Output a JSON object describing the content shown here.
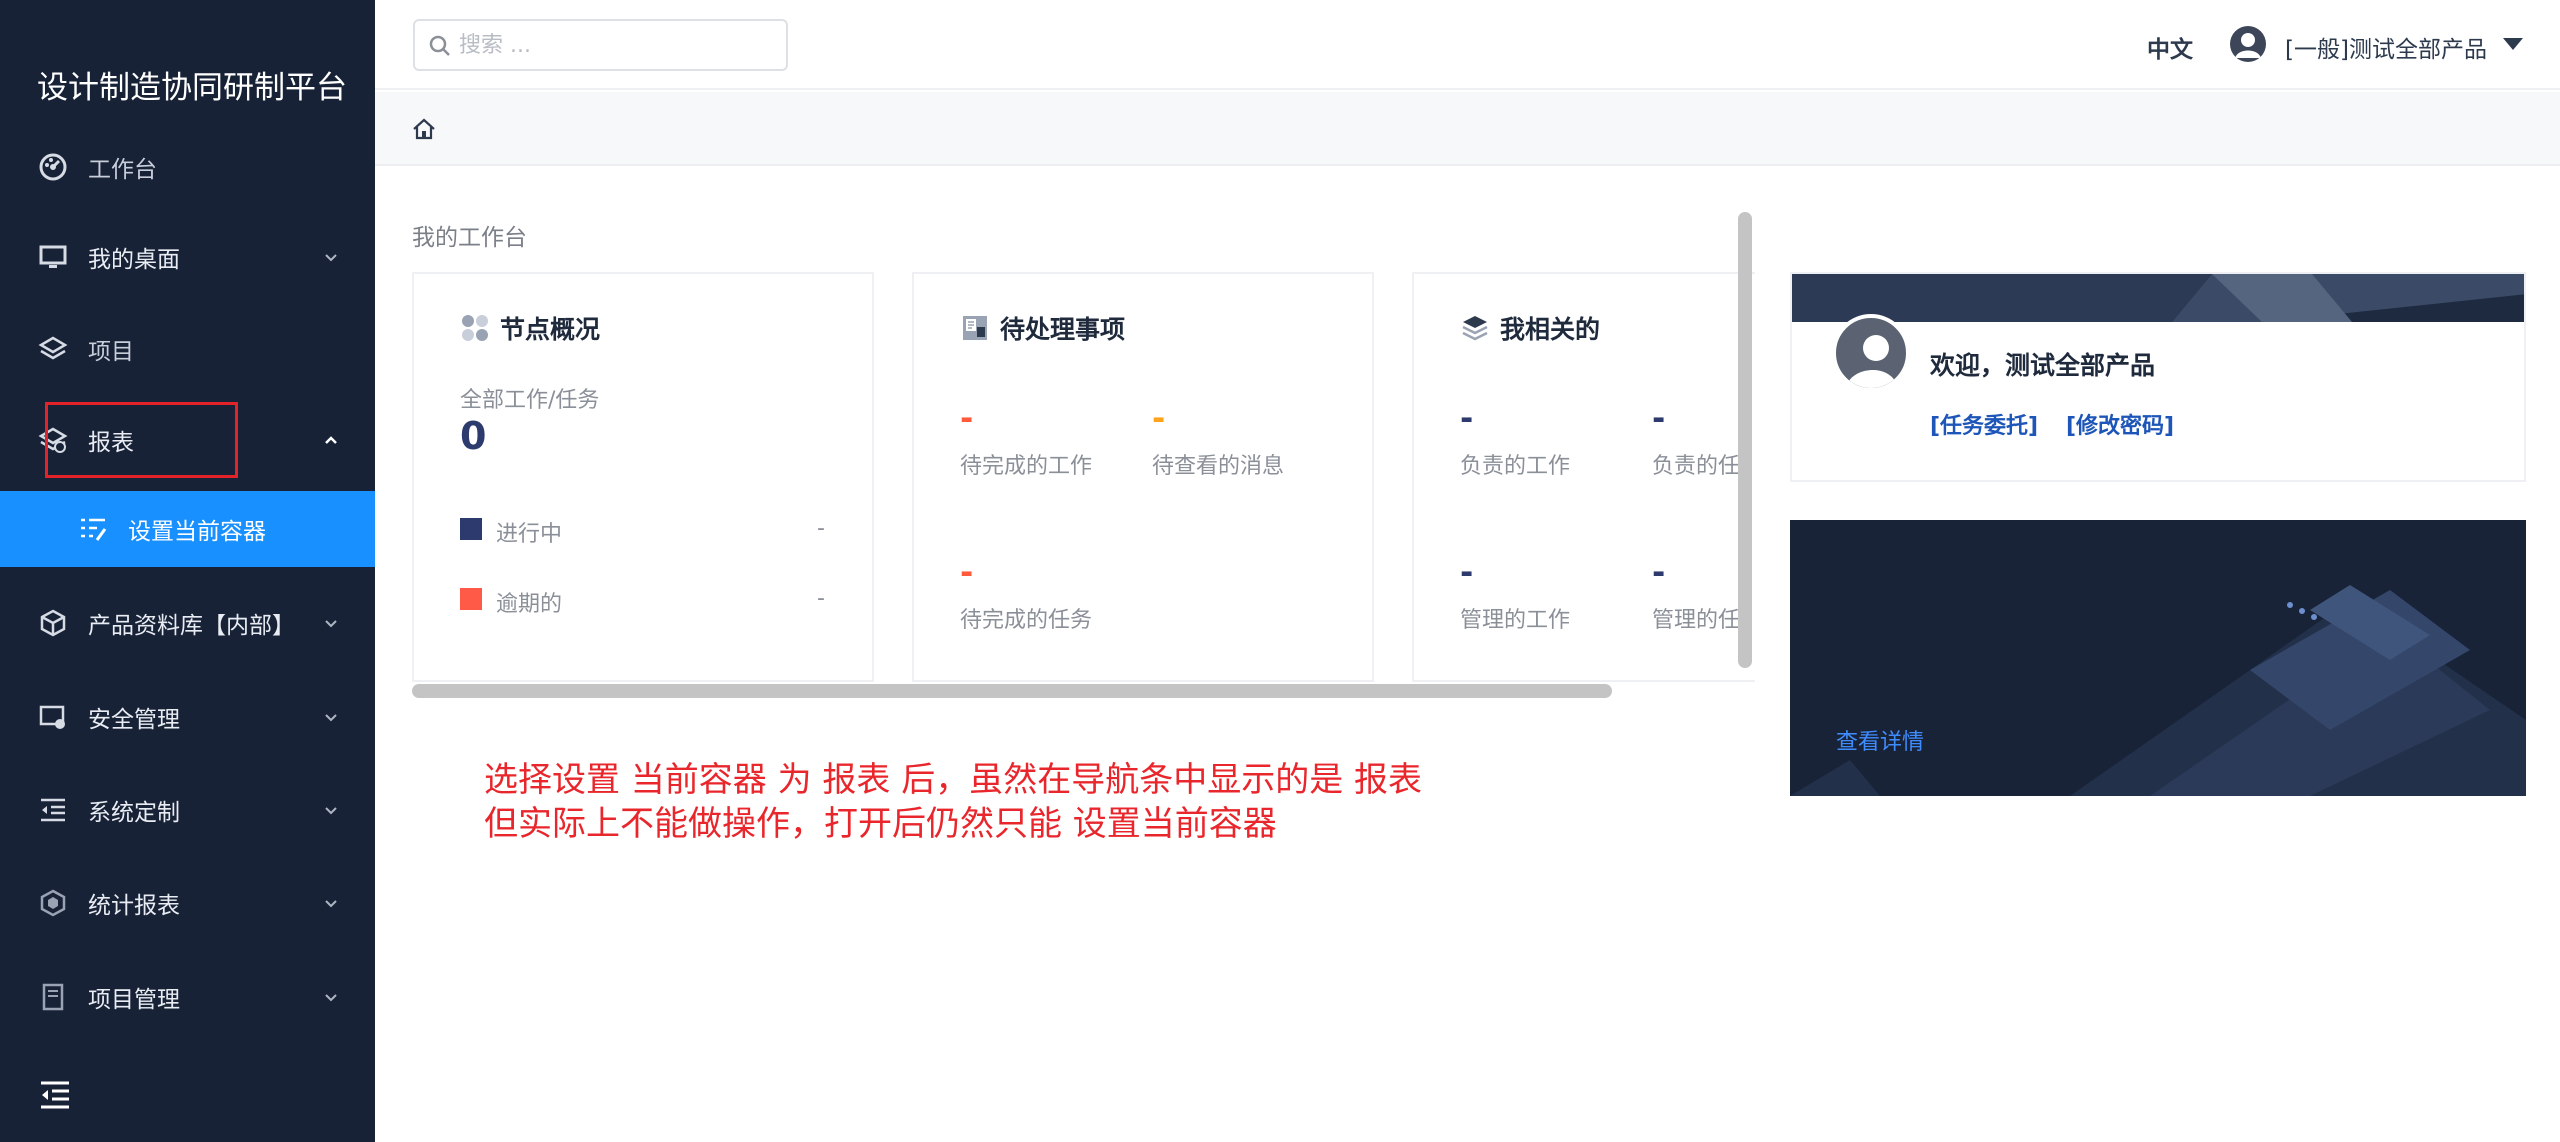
{
  "sidebar": {
    "title": "设计制造协同研制平台",
    "items": [
      {
        "label": "工作台",
        "icon": "dashboard-icon"
      },
      {
        "label": "我的桌面",
        "icon": "monitor-icon"
      },
      {
        "label": "项目",
        "icon": "layers-icon"
      },
      {
        "label": "报表",
        "icon": "report-icon"
      },
      {
        "label": "设置当前容器",
        "icon": "edit-list-icon"
      },
      {
        "label": "产品资料库【内部】",
        "icon": "cube-icon"
      },
      {
        "label": "安全管理",
        "icon": "security-screen-icon"
      },
      {
        "label": "系统定制",
        "icon": "indent-icon"
      },
      {
        "label": "统计报表",
        "icon": "hexagon-icon"
      },
      {
        "label": "项目管理",
        "icon": "book-icon"
      }
    ]
  },
  "header": {
    "search_placeholder": "搜索 ...",
    "language": "中文",
    "user": "[一般]测试全部产品"
  },
  "main": {
    "section_title": "我的工作台",
    "card_nodes": {
      "title": "节点概况",
      "subtitle": "全部工作/任务",
      "total": "0",
      "in_progress_label": "进行中",
      "in_progress_value": "-",
      "overdue_label": "逾期的",
      "overdue_value": "-"
    },
    "card_pending": {
      "title": "待处理事项",
      "items": [
        {
          "value": "-",
          "label": "待完成的工作"
        },
        {
          "value": "-",
          "label": "待查看的消息"
        },
        {
          "value": "-",
          "label": "待完成的任务"
        }
      ]
    },
    "card_related": {
      "title": "我相关的",
      "items": [
        {
          "value": "-",
          "label": "负责的工作"
        },
        {
          "value": "-",
          "label": "负责的任"
        },
        {
          "value": "-",
          "label": "管理的工作"
        },
        {
          "value": "-",
          "label": "管理的任"
        }
      ]
    }
  },
  "welcome": {
    "title": "欢迎，测试全部产品",
    "link_delegate": "[任务委托]",
    "link_password": "[修改密码]"
  },
  "promo": {
    "link": "查看详情"
  },
  "annotation": {
    "line1": "选择设置 当前容器 为 报表 后，虽然在导航条中显示的是 报表",
    "line2": "但实际上不能做操作，打开后仍然只能 设置当前容器"
  },
  "colors": {
    "sidebar_bg": "#172237",
    "active_item": "#1890ff",
    "highlight_box": "#e3232a",
    "dash_red": "#ff5a3c",
    "dash_orange": "#ffa31a",
    "dash_navy": "#2d3a6e",
    "link_blue": "#1d56b8",
    "annotation_red": "#e8262b"
  }
}
